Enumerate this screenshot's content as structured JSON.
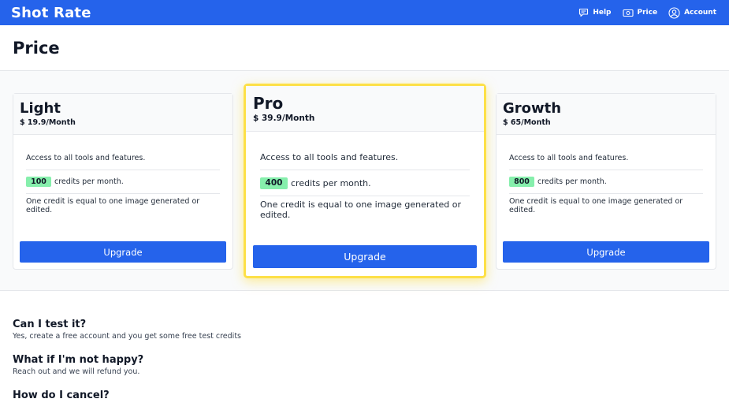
{
  "header": {
    "brand": "Shot Rate",
    "nav": [
      {
        "label": "Help",
        "icon": "chat-icon"
      },
      {
        "label": "Price",
        "icon": "money-icon"
      },
      {
        "label": "Account",
        "icon": "user-circle-icon"
      }
    ]
  },
  "page": {
    "title": "Price"
  },
  "plans": [
    {
      "name": "Light",
      "price": "$ 19.9/Month",
      "features": {
        "access": "Access to all tools and features.",
        "credits": "100",
        "credits_suffix": "credits per month.",
        "credit_note": "One credit is equal to one image generated or edited."
      },
      "button": "Upgrade",
      "featured": false
    },
    {
      "name": "Pro",
      "price": "$ 39.9/Month",
      "features": {
        "access": "Access to all tools and features.",
        "credits": "400",
        "credits_suffix": "credits per month.",
        "credit_note": "One credit is equal to one image generated or edited."
      },
      "button": "Upgrade",
      "featured": true
    },
    {
      "name": "Growth",
      "price": "$ 65/Month",
      "features": {
        "access": "Access to all tools and features.",
        "credits": "800",
        "credits_suffix": "credits per month.",
        "credit_note": "One credit is equal to one image generated or edited."
      },
      "button": "Upgrade",
      "featured": false
    }
  ],
  "faq": [
    {
      "question": "Can I test it?",
      "answer": "Yes, create a free account and you get some free test credits"
    },
    {
      "question": "What if I'm not happy?",
      "answer": "Reach out and we will refund you."
    },
    {
      "question": "How do I cancel?",
      "answer": ""
    }
  ],
  "colors": {
    "primary": "#2563eb",
    "badge": "#86efac",
    "featured_border": "#fde047"
  }
}
